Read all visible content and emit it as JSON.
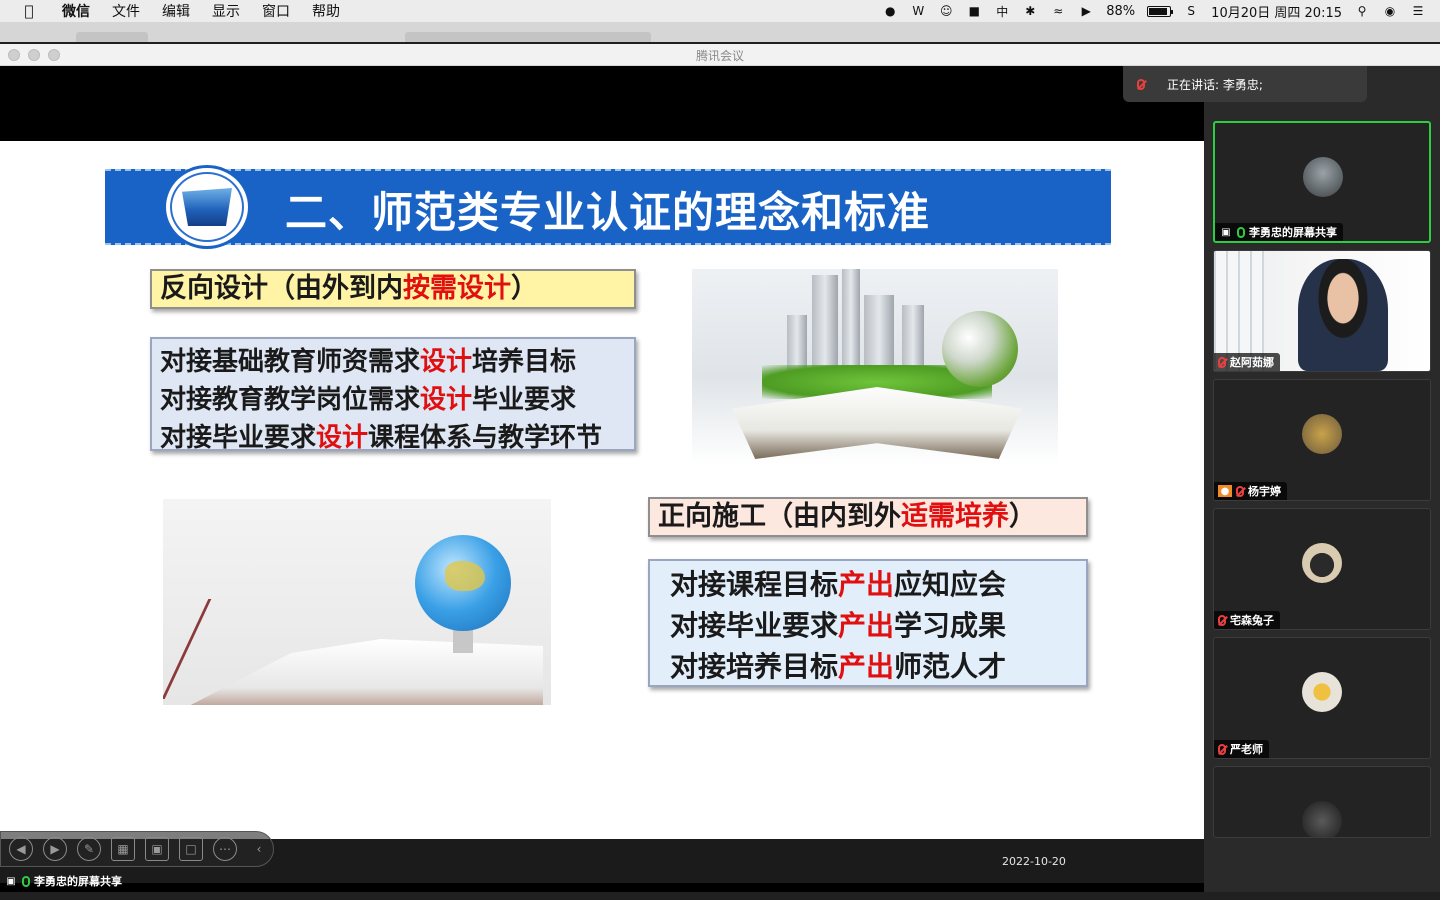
{
  "menubar": {
    "app": "微信",
    "items": [
      "文件",
      "编辑",
      "显示",
      "窗口",
      "帮助"
    ],
    "battery": "88%",
    "datetime": "10月20日 周四  20:15"
  },
  "window": {
    "title": "腾讯会议"
  },
  "slide": {
    "heading": "二、师范类专业认证的理念和标准",
    "reverse_design": {
      "prefix": "反向设计（由外到内",
      "highlight": "按需设计",
      "suffix": "）"
    },
    "reverse_list": [
      {
        "a": "对接基础教育师资需求",
        "b": "设计",
        "c": "培养目标"
      },
      {
        "a": "对接教育教学岗位需求",
        "b": "设计",
        "c": "毕业要求"
      },
      {
        "a": "对接毕业要求",
        "b": "设计",
        "c": "课程体系与教学环节"
      }
    ],
    "forward_build": {
      "prefix": "正向施工（由内到外",
      "highlight": "适需培养",
      "suffix": "）"
    },
    "forward_list": [
      {
        "a": "对接课程目标",
        "b": "产出",
        "c": "应知应会"
      },
      {
        "a": "对接毕业要求",
        "b": "产出",
        "c": "学习成果"
      },
      {
        "a": "对接培养目标",
        "b": "产出",
        "c": "师范人才"
      }
    ],
    "date": "2022-10-20"
  },
  "share": {
    "label": "李勇忠的屏幕共享"
  },
  "speaking": {
    "label": "正在讲话: 李勇忠;"
  },
  "participants": [
    {
      "name": "李勇忠的屏幕共享",
      "mic": "on",
      "active": true
    },
    {
      "name": "赵阿茹娜",
      "mic": "muted",
      "active": false,
      "video": true
    },
    {
      "name": "杨宇婷",
      "mic": "muted",
      "active": false
    },
    {
      "name": "宅森兔子",
      "mic": "muted",
      "active": false
    },
    {
      "name": "严老师",
      "mic": "muted",
      "active": false
    },
    {
      "name": "",
      "mic": "muted",
      "active": false
    }
  ],
  "colors": {
    "accent_green": "#2ecc40",
    "banner_blue": "#1a63c6",
    "highlight_red": "#e01010"
  }
}
